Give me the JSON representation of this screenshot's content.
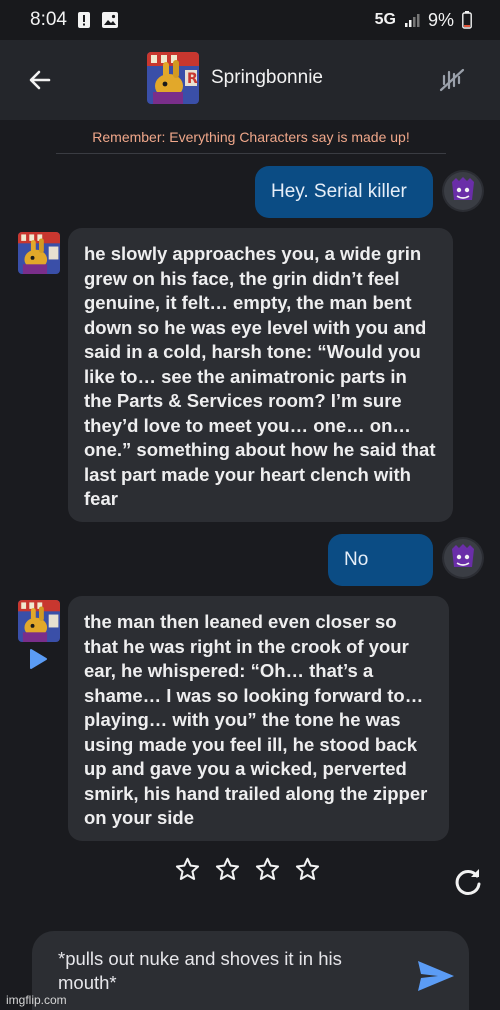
{
  "status_bar": {
    "time": "8:04",
    "network": "5G",
    "battery": "9%"
  },
  "header": {
    "title": "Springbonnie",
    "back_icon": "back-arrow-icon",
    "voice_icon": "voice-muted-icon",
    "avatar_icon": "character-avatar"
  },
  "disclaimer": "Remember: Everything Characters say is made up!",
  "messages": [
    {
      "role": "user",
      "text": "Hey. Serial killer"
    },
    {
      "role": "char",
      "text": "he slowly approaches you, a wide grin grew on his face, the grin didn’t feel genuine, it felt… empty, the man bent down so he was eye level with you and said in a cold, harsh tone: “Would you like to… see the animatronic parts in the Parts & Services room? I’m sure they’d love to meet you… one… on… one.” something about how he said that last part made your heart clench with fear"
    },
    {
      "role": "user",
      "text": "No"
    },
    {
      "role": "char",
      "text": "the man then leaned even closer so that he was right in the crook of your ear, he whispered: “Oh… that’s a shame… I was so looking forward to… playing… with you” the tone he was using made you feel ill, he stood back up and gave you a wicked, perverted smirk, his hand trailed along the zipper on your side"
    }
  ],
  "rating": {
    "stars": 4,
    "selected": 0
  },
  "composer": {
    "value": "*pulls out nuke and shoves it in his mouth*"
  },
  "watermark": "imgflip.com",
  "colors": {
    "background": "#1a1b1f",
    "header": "#24262b",
    "user_bubble": "#0b4c84",
    "char_bubble": "#2c2e33",
    "disclaimer": "#f0a78a",
    "send": "#5b9cf5"
  }
}
